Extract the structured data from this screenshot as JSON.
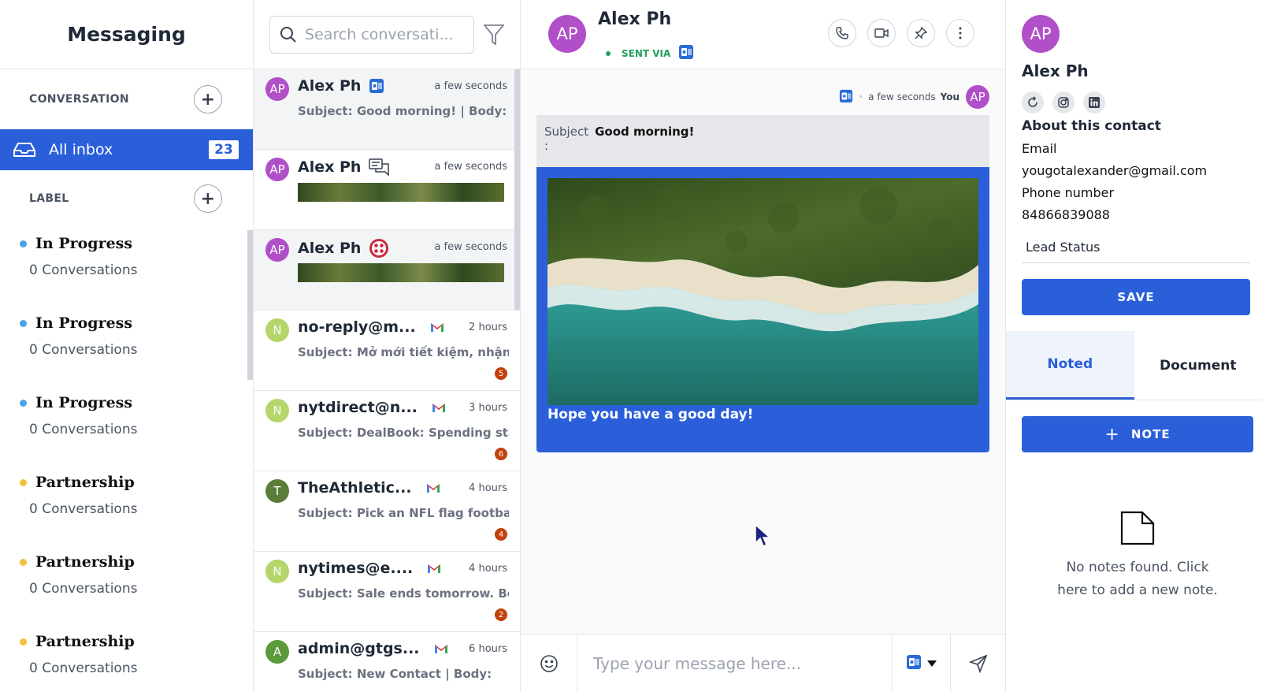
{
  "sidebar": {
    "title": "Messaging",
    "conversation_header": "CONVERSATION",
    "all_inbox": {
      "label": "All inbox",
      "count": "23"
    },
    "label_header": "LABEL",
    "labels": [
      {
        "name": "In Progress",
        "count": "0 Conversations",
        "color": "#4aa3e8"
      },
      {
        "name": "In Progress",
        "count": "0 Conversations",
        "color": "#4aa3e8"
      },
      {
        "name": "In Progress",
        "count": "0 Conversations",
        "color": "#4aa3e8"
      },
      {
        "name": "Partnership",
        "count": "0 Conversations",
        "color": "#f0c040"
      },
      {
        "name": "Partnership",
        "count": "0 Conversations",
        "color": "#f0c040"
      },
      {
        "name": "Partnership",
        "count": "0 Conversations",
        "color": "#f0c040"
      }
    ]
  },
  "list": {
    "search_placeholder": "Search conversati...",
    "items": [
      {
        "initials": "AP",
        "name": "Alex Ph",
        "channel": "outlook-icon",
        "time": "a few seconds",
        "subject": "Subject: Good morning! | Body:",
        "avatar_color": "#b04fc8"
      },
      {
        "initials": "AP",
        "name": "Alex Ph",
        "channel": "chat-icon",
        "time": "a few seconds",
        "avatar_color": "#b04fc8"
      },
      {
        "initials": "AP",
        "name": "Alex Ph",
        "channel": "lifesaver-icon",
        "time": "a few seconds",
        "avatar_color": "#b04fc8"
      },
      {
        "initials": "N",
        "name": "no-reply@m...",
        "channel": "gmail-icon",
        "time": "2 hours",
        "subject": "Subject: Mở mới tiết kiệm, nhận thêm",
        "badge": "5",
        "avatar_color": "#b5d66a"
      },
      {
        "initials": "N",
        "name": "nytdirect@n...",
        "channel": "gmail-icon",
        "time": "3 hours",
        "subject": "Subject: DealBook: Spending standoff",
        "badge": "6",
        "avatar_color": "#b5d66a"
      },
      {
        "initials": "T",
        "name": "TheAthletic...",
        "channel": "gmail-icon",
        "time": "4 hours",
        "subject": "Subject: Pick an NFL flag football team",
        "badge": "4",
        "avatar_color": "#5a7d3a"
      },
      {
        "initials": "N",
        "name": "nytimes@e....",
        "channel": "gmail-icon",
        "time": "4 hours",
        "subject": "Subject: Sale ends tomorrow. Benefit",
        "badge": "2",
        "avatar_color": "#b5d66a"
      },
      {
        "initials": "A",
        "name": "admin@gtgs...",
        "channel": "gmail-icon",
        "time": "6 hours",
        "subject": "Subject: New Contact | Body:",
        "avatar_color": "#5a9a3a"
      }
    ]
  },
  "chat": {
    "initials": "AP",
    "name": "Alex Ph",
    "sent_via": "SENT VIA",
    "meta_time": "a few seconds",
    "meta_you": "You",
    "subject_label": "Subject",
    "subject_value": "Good morning!",
    "subject_colon": ":",
    "caption": "Hope you have a good day!",
    "input_placeholder": "Type your message here..."
  },
  "contact": {
    "initials": "AP",
    "name": "Alex Ph",
    "about": "About this contact",
    "email_label": "Email",
    "email": "yougotalexander@gmail.com",
    "phone_label": "Phone number",
    "phone": "84866839088",
    "lead_status": "Lead Status",
    "save": "SAVE",
    "tab_noted": "Noted",
    "tab_document": "Document",
    "note_button": "NOTE",
    "empty_text": "No notes found. Click here to add a new note."
  },
  "colors": {
    "primary": "#2b5fd9",
    "avatar": "#b04fc8"
  }
}
